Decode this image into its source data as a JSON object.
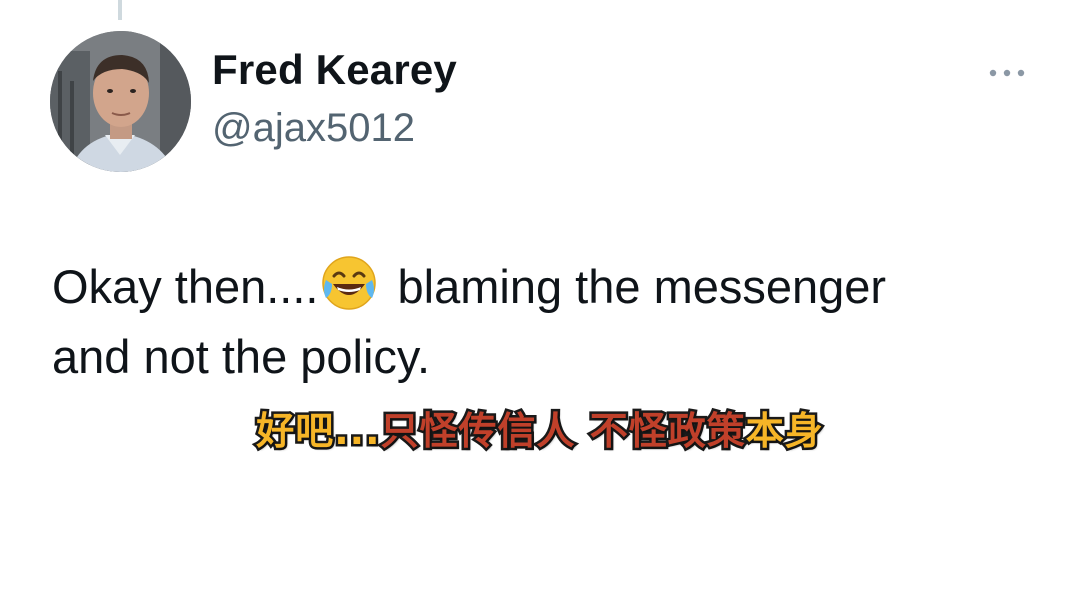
{
  "tweet": {
    "display_name": "Fred Kearey",
    "handle": "@ajax5012",
    "text_line1_a": "Okay then....",
    "emoji": "face-with-tears-of-joy",
    "text_line1_b": " blaming the messenger",
    "text_line2": "and not the policy."
  },
  "subtitle": {
    "part1": "好吧...",
    "part2": "只怪传信人 不怪政策",
    "part3": "本身"
  },
  "colors": {
    "text": "#0f1419",
    "handle": "#536471",
    "subtitle_yellow": "#f6b527",
    "subtitle_red": "#c0402a"
  },
  "icons": {
    "more": "more-horizontal-icon",
    "avatar": "user-avatar-photo"
  }
}
